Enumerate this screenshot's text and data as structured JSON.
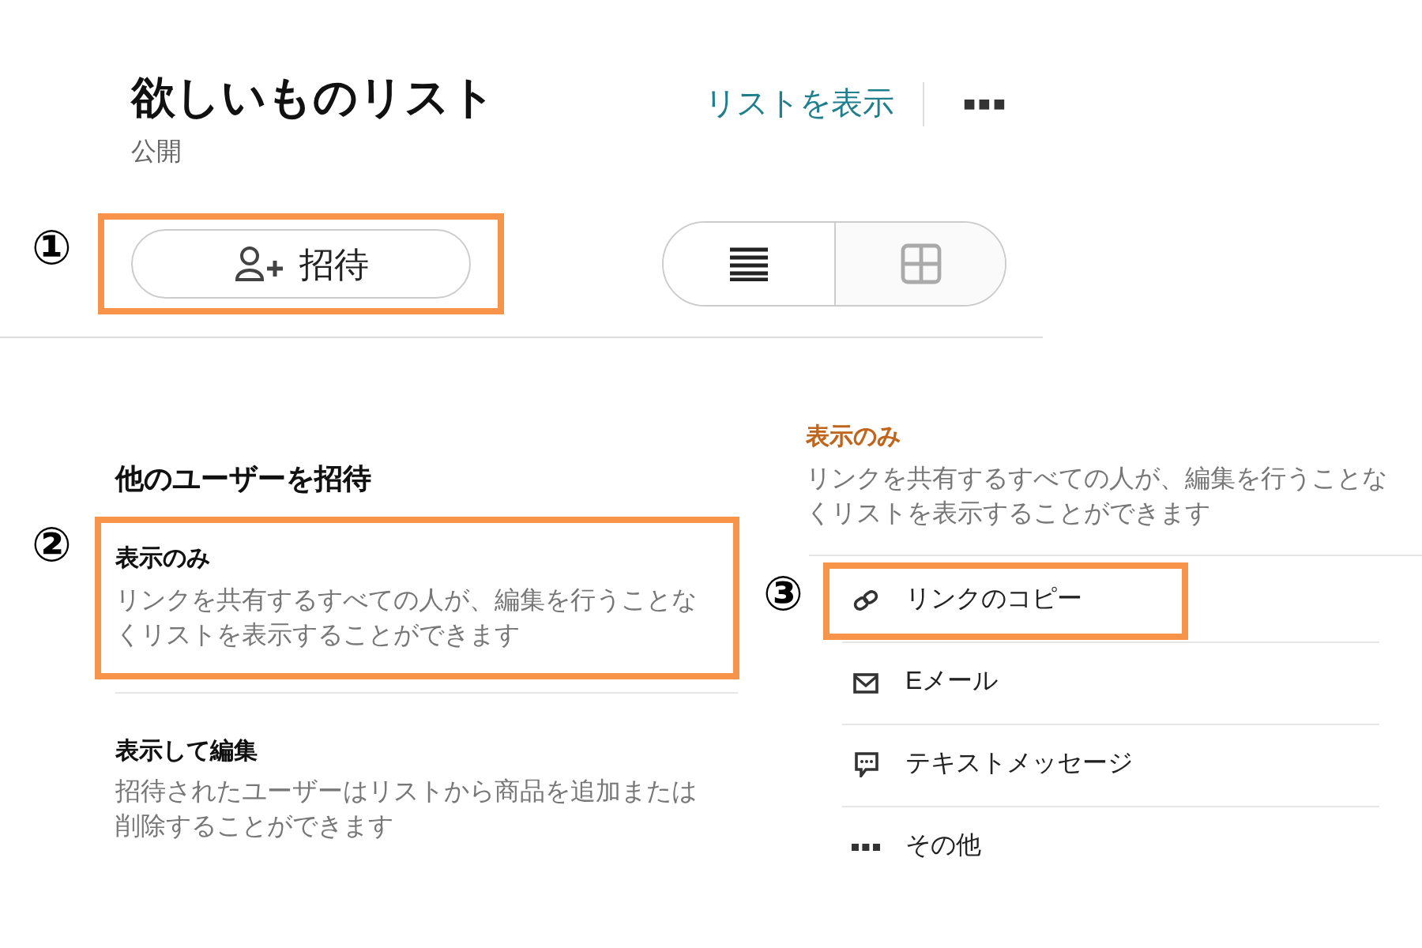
{
  "header": {
    "title": "欲しいものリスト",
    "privacy": "公開",
    "view_link": "リストを表示"
  },
  "invite": {
    "step": "①",
    "label": "招待",
    "highlighted": true
  },
  "view_toggle": [
    {
      "kind": "list",
      "selected": true
    },
    {
      "kind": "grid",
      "selected": false
    }
  ],
  "invite_panel": {
    "title": "他のユーザーを招待",
    "options": [
      {
        "step": "②",
        "title": "表示のみ",
        "description": "リンクを共有するすべての人が、編集を行うことなくリストを表示することができます",
        "highlighted": true
      },
      {
        "title": "表示して編集",
        "description": "招待されたユーザーはリストから商品を追加または削除することができます",
        "highlighted": false
      }
    ]
  },
  "share_panel": {
    "title": "表示のみ",
    "description": "リンクを共有するすべての人が、編集を行うことなくリストを表示することができます",
    "actions": [
      {
        "kind": "link",
        "label": "リンクのコピー",
        "step": "③",
        "highlighted": true
      },
      {
        "kind": "email",
        "label": "Eメール",
        "highlighted": false
      },
      {
        "kind": "message",
        "label": "テキストメッセージ",
        "highlighted": false
      },
      {
        "kind": "more",
        "label": "その他",
        "highlighted": false
      }
    ]
  }
}
